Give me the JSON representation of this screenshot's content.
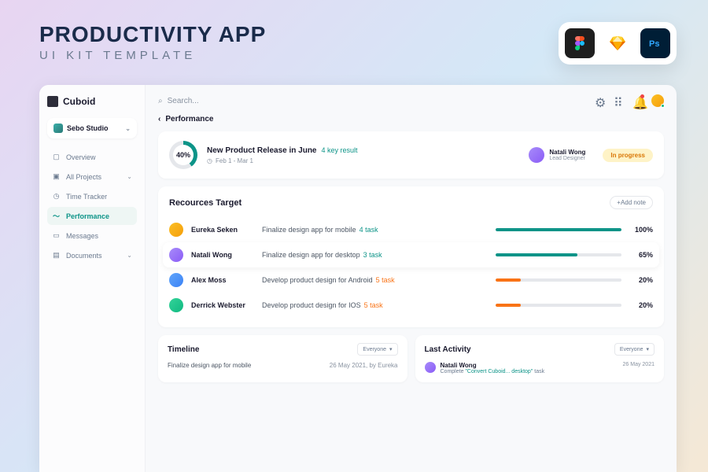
{
  "hero": {
    "title": "PRODUCTIVITY APP",
    "subtitle": "UI KIT TEMPLATE"
  },
  "brand": "Cuboid",
  "workspace": "Sebo Studio",
  "search_placeholder": "Search...",
  "nav": {
    "overview": "Overview",
    "projects": "All Projects",
    "tracker": "Time Tracker",
    "performance": "Performance",
    "messages": "Messages",
    "documents": "Documents"
  },
  "breadcrumb": "Performance",
  "goal": {
    "percent": "40%",
    "title": "New Product Release in June",
    "key_result": "4 key result",
    "date": "Feb 1 - Mar 1",
    "assignee_name": "Natali Wong",
    "assignee_role": "Lead Designer",
    "status": "In progress"
  },
  "resources": {
    "title": "Recources Target",
    "add_note": "+Add note",
    "rows": [
      {
        "name": "Eureka Seken",
        "task": "Finalize design app for mobile",
        "count": "4 task",
        "count_color": "#0d9488",
        "pct": "100%",
        "fill": "100%",
        "color": "#0d9488",
        "av": "linear-gradient(135deg,#fbbf24,#f59e0b)"
      },
      {
        "name": "Natali Wong",
        "task": "Finalize design app for desktop",
        "count": "3 task",
        "count_color": "#0d9488",
        "pct": "65%",
        "fill": "65%",
        "color": "#0d9488",
        "av": "linear-gradient(135deg,#a78bfa,#8b5cf6)",
        "highlight": true
      },
      {
        "name": "Alex Moss",
        "task": "Develop product design for Android",
        "count": "5 task",
        "count_color": "#f97316",
        "pct": "20%",
        "fill": "20%",
        "color": "#f97316",
        "av": "linear-gradient(135deg,#60a5fa,#3b82f6)"
      },
      {
        "name": "Derrick Webster",
        "task": "Develop product design for IOS",
        "count": "5 task",
        "count_color": "#f97316",
        "pct": "20%",
        "fill": "20%",
        "color": "#f97316",
        "av": "linear-gradient(135deg,#34d399,#10b981)"
      }
    ]
  },
  "timeline": {
    "title": "Timeline",
    "filter": "Everyone",
    "item_task": "Finalize design app for mobile",
    "item_date": "26 May 2021, by Eureka"
  },
  "activity": {
    "title": "Last Activity",
    "filter": "Everyone",
    "name": "Natali Wong",
    "desc_prefix": "Complete ",
    "desc_link": "\"Convert Cuboid... desktop\"",
    "desc_suffix": " task",
    "date": "26 May 2021"
  }
}
